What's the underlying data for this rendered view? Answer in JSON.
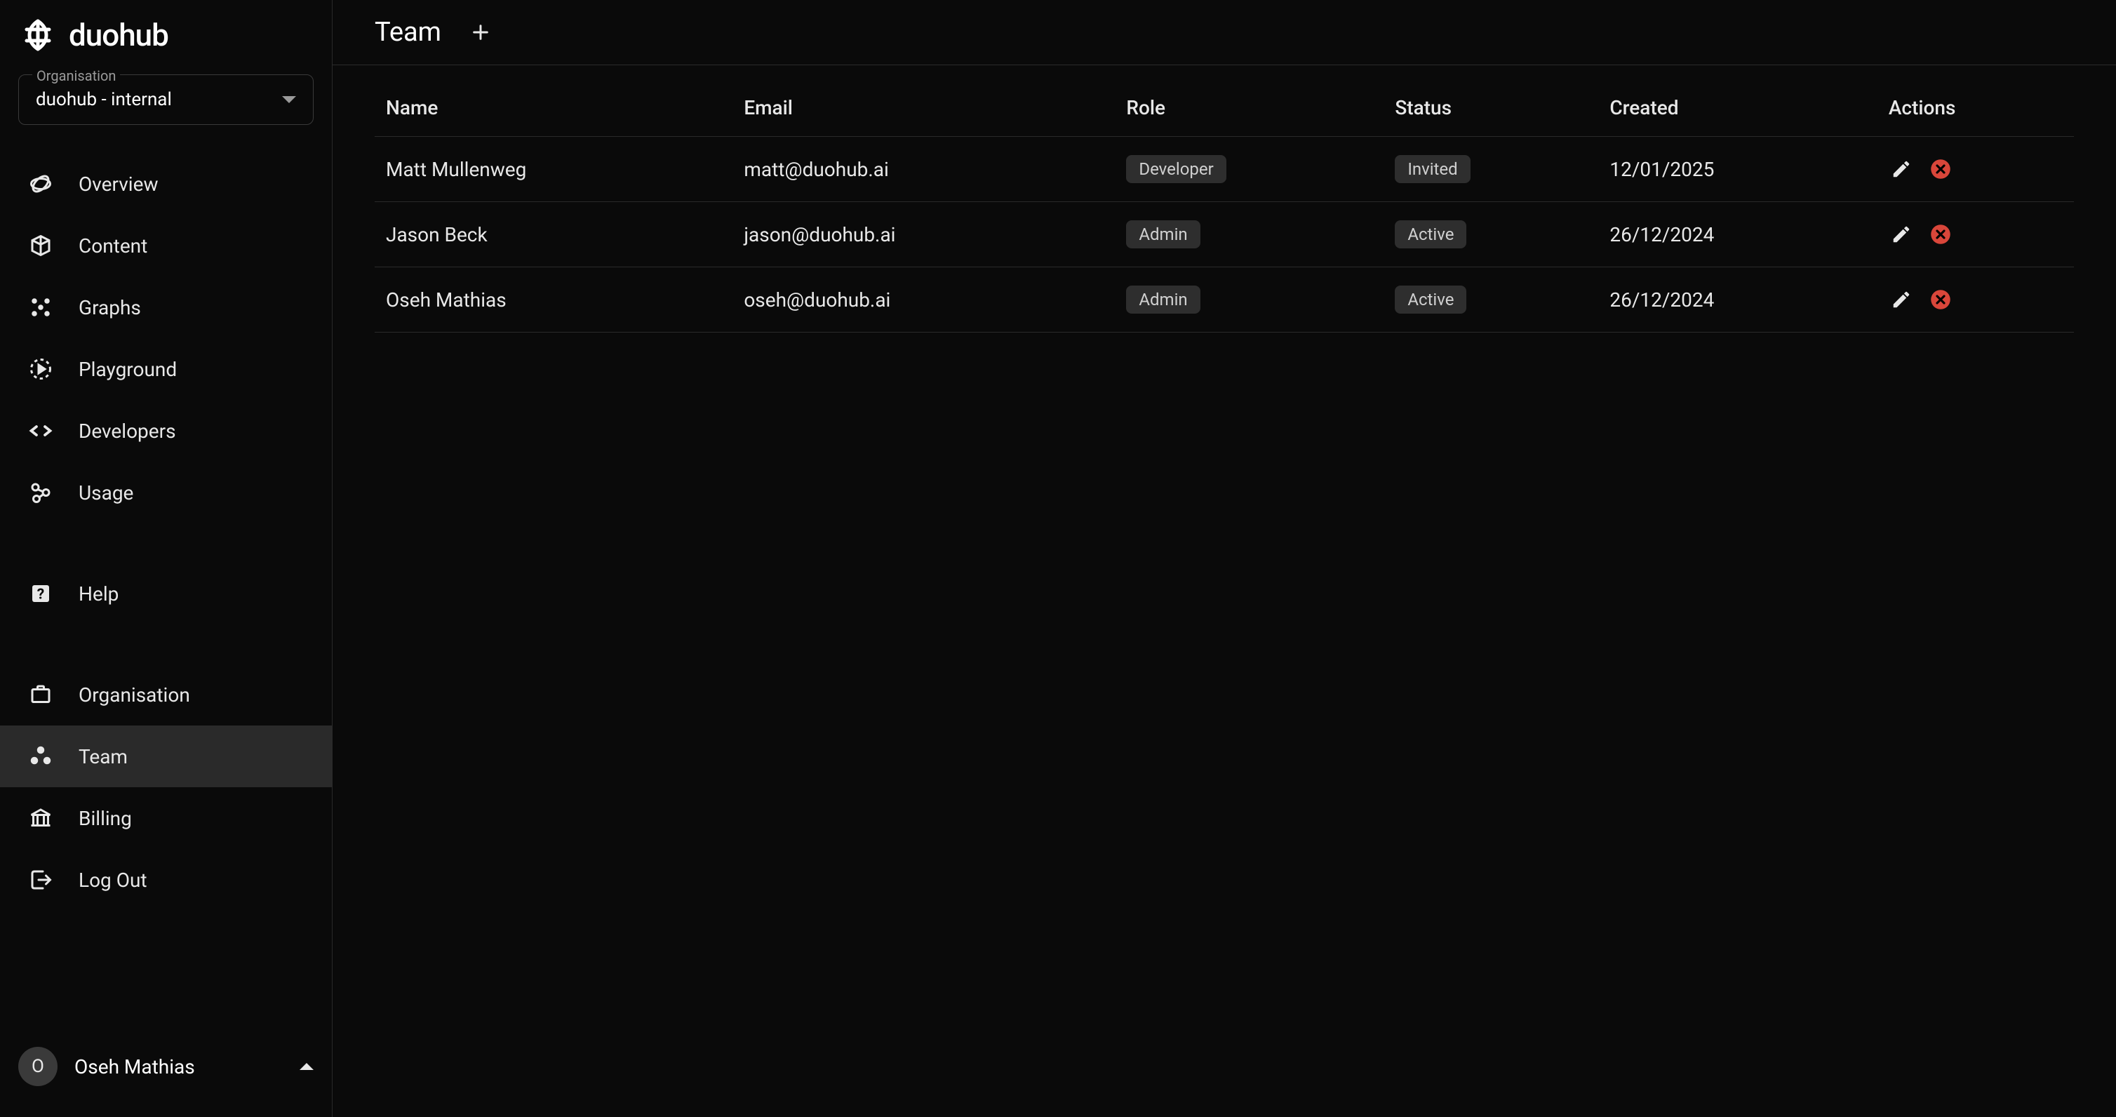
{
  "app": {
    "name": "duohub"
  },
  "org": {
    "label": "Organisation",
    "selected": "duohub - internal"
  },
  "nav": {
    "primary": [
      {
        "id": "overview",
        "label": "Overview",
        "icon": "overview"
      },
      {
        "id": "content",
        "label": "Content",
        "icon": "content"
      },
      {
        "id": "graphs",
        "label": "Graphs",
        "icon": "graphs"
      },
      {
        "id": "playground",
        "label": "Playground",
        "icon": "playground"
      },
      {
        "id": "developers",
        "label": "Developers",
        "icon": "developers"
      },
      {
        "id": "usage",
        "label": "Usage",
        "icon": "usage"
      }
    ],
    "secondary": [
      {
        "id": "help",
        "label": "Help",
        "icon": "help"
      }
    ],
    "tertiary": [
      {
        "id": "organisation",
        "label": "Organisation",
        "icon": "organisation"
      },
      {
        "id": "team",
        "label": "Team",
        "icon": "team",
        "active": true
      },
      {
        "id": "billing",
        "label": "Billing",
        "icon": "billing"
      },
      {
        "id": "logout",
        "label": "Log Out",
        "icon": "logout"
      }
    ]
  },
  "user": {
    "name": "Oseh Mathias",
    "initial": "O"
  },
  "page": {
    "title": "Team"
  },
  "table": {
    "columns": [
      "Name",
      "Email",
      "Role",
      "Status",
      "Created",
      "Actions"
    ],
    "rows": [
      {
        "name": "Matt Mullenweg",
        "email": "matt@duohub.ai",
        "role": "Developer",
        "status": "Invited",
        "created": "12/01/2025"
      },
      {
        "name": "Jason Beck",
        "email": "jason@duohub.ai",
        "role": "Admin",
        "status": "Active",
        "created": "26/12/2024"
      },
      {
        "name": "Oseh Mathias",
        "email": "oseh@duohub.ai",
        "role": "Admin",
        "status": "Active",
        "created": "26/12/2024"
      }
    ]
  }
}
